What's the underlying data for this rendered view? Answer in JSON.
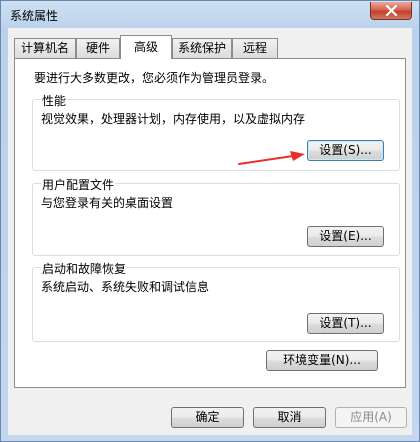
{
  "window": {
    "title": "系统属性",
    "close_label": "✕"
  },
  "tabs": [
    {
      "label": "计算机名",
      "active": false
    },
    {
      "label": "硬件",
      "active": false
    },
    {
      "label": "高级",
      "active": true
    },
    {
      "label": "系统保护",
      "active": false
    },
    {
      "label": "远程",
      "active": false
    }
  ],
  "advanced": {
    "admin_note": "要进行大多数更改，您必须作为管理员登录。",
    "performance": {
      "title": "性能",
      "description": "视觉效果，处理器计划，内存使用，以及虚拟内存",
      "button": "设置(S)..."
    },
    "user_profiles": {
      "title": "用户配置文件",
      "description": "与您登录有关的桌面设置",
      "button": "设置(E)..."
    },
    "startup_recovery": {
      "title": "启动和故障恢复",
      "description": "系统启动、系统失败和调试信息",
      "button": "设置(T)..."
    },
    "env_vars_button": "环境变量(N)..."
  },
  "footer": {
    "ok": "确定",
    "cancel": "取消",
    "apply": "应用(A)",
    "apply_enabled": false
  },
  "colors": {
    "annotation_arrow": "#e8302a",
    "focus_border": "#3c7fb1"
  }
}
